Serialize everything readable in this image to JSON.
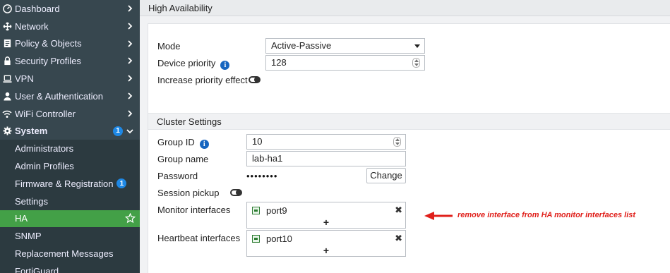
{
  "sidebar": {
    "items": [
      {
        "label": "Dashboard",
        "icon": "dashboard-icon"
      },
      {
        "label": "Network",
        "icon": "network-icon"
      },
      {
        "label": "Policy & Objects",
        "icon": "policy-icon"
      },
      {
        "label": "Security Profiles",
        "icon": "lock-icon"
      },
      {
        "label": "VPN",
        "icon": "laptop-icon"
      },
      {
        "label": "User & Authentication",
        "icon": "user-icon"
      },
      {
        "label": "WiFi Controller",
        "icon": "wifi-icon"
      }
    ],
    "system": {
      "label": "System",
      "badge": "1",
      "icon": "gear-icon"
    },
    "sub_items": [
      {
        "label": "Administrators"
      },
      {
        "label": "Admin Profiles"
      },
      {
        "label": "Firmware & Registration",
        "badge": "1"
      },
      {
        "label": "Settings"
      },
      {
        "label": "HA",
        "active": true
      },
      {
        "label": "SNMP"
      },
      {
        "label": "Replacement Messages"
      },
      {
        "label": "FortiGuard"
      }
    ],
    "colors": {
      "background": "#37474f",
      "active": "#43a047",
      "badge": "#1e88e5"
    }
  },
  "page": {
    "title": "High Availability"
  },
  "ha": {
    "mode_label": "Mode",
    "mode_value": "Active-Passive",
    "priority_label": "Device priority",
    "priority_value": "128",
    "increase_label": "Increase priority effect"
  },
  "cluster": {
    "section_title": "Cluster Settings",
    "group_id_label": "Group ID",
    "group_id_value": "10",
    "group_name_label": "Group name",
    "group_name_value": "lab-ha1",
    "password_label": "Password",
    "password_value": "••••••••",
    "change_label": "Change",
    "session_pickup_label": "Session pickup",
    "monitor_label": "Monitor interfaces",
    "monitor_value": "port9",
    "heartbeat_label": "Heartbeat interfaces",
    "heartbeat_value": "port10",
    "add_symbol": "+",
    "remove_symbol": "✖"
  },
  "annotation": {
    "text": "remove interface from HA monitor interfaces list",
    "color": "#e0201b"
  }
}
